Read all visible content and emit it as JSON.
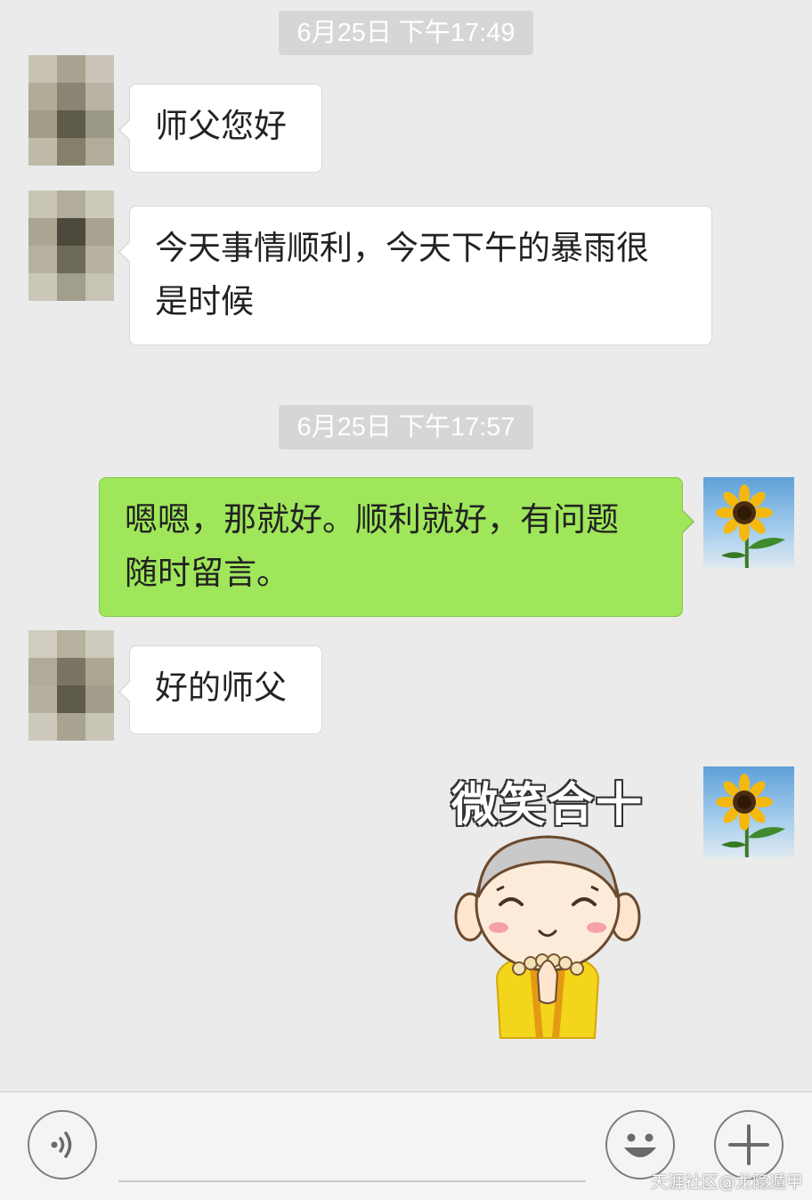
{
  "messages": {
    "ts1": "6月25日 下午17:49",
    "m1": "师父您好",
    "m2_line1": "今天事情顺利，今天下午的暴雨很",
    "m2_line2": "是时候",
    "ts2": "6月25日 下午17:57",
    "m3_line1": "嗯嗯，那就好。顺利就好，有问题",
    "m3_line2": "随时留言。",
    "m4": "好的师父",
    "sticker_text": "微笑合十"
  },
  "icons": {
    "voice": "voice-icon",
    "emoji": "emoji-icon",
    "add": "plus-icon",
    "self_avatar": "sunflower-avatar"
  },
  "colors": {
    "background": "#ebebeb",
    "sent_bubble": "#9fe65a",
    "received_bubble": "#ffffff"
  },
  "watermark": "天涯社区@龙隐遁甲"
}
